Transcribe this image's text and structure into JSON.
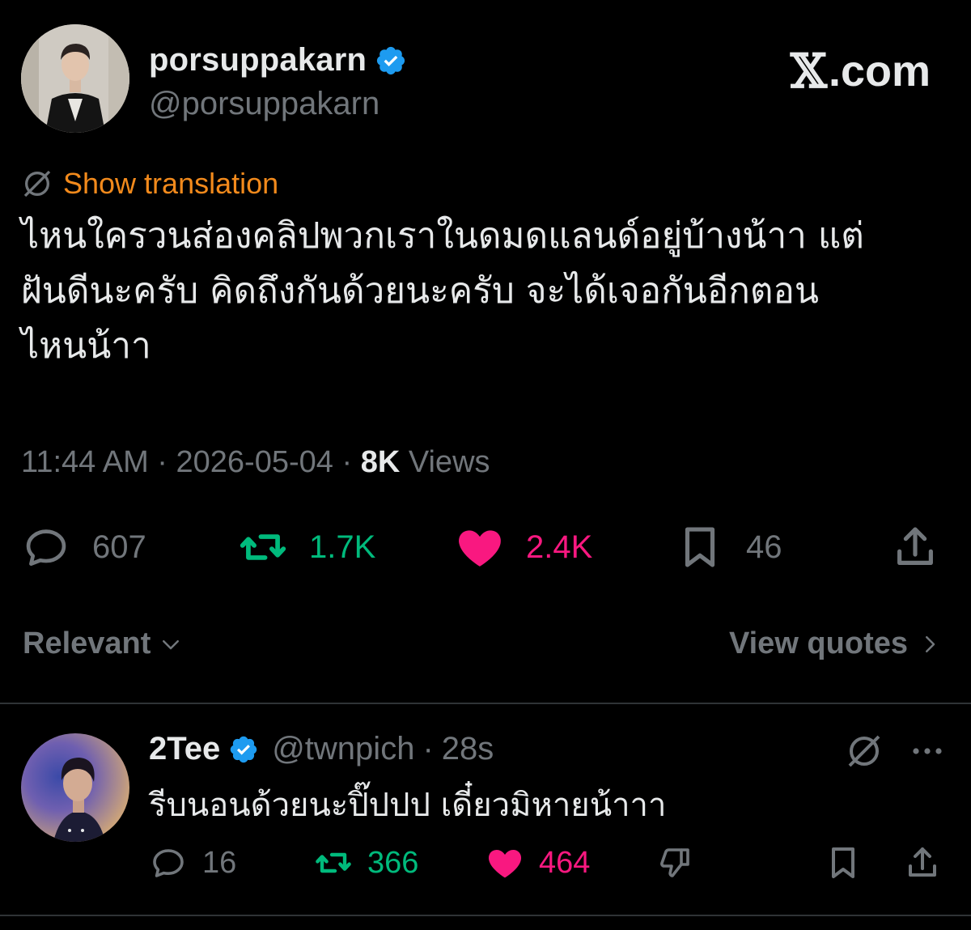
{
  "author": {
    "display_name": "porsuppakarn",
    "handle": "@porsuppakarn",
    "verified_color": "#1d9bf0"
  },
  "brand": {
    "logo_text": "com",
    "logo_prefix": "X."
  },
  "translation": {
    "label": "Show translation",
    "color": "#f28a1c"
  },
  "tweet": {
    "text_line1": "ไหนใครวนส่องคลิปพวกเราในดมดแลนด์อยู่บ้างน้าา แต่",
    "text_line2": "ฝันดีนะครับ คิดถึงกันด้วยนะครับ จะได้เจอกันอีกตอน",
    "text_line3": "ไหนน้าา",
    "time": "11:44 AM",
    "date": "2026-05-04",
    "views_count": "8K",
    "views_label": "Views"
  },
  "stats": {
    "replies": "607",
    "reposts": "1.7K",
    "likes": "2.4K",
    "bookmarks": "46"
  },
  "colors": {
    "repost": "#00ba7c",
    "like": "#f91880",
    "muted": "#71767b",
    "text": "#e7e9ea"
  },
  "sort": {
    "label": "Relevant",
    "view_quotes": "View quotes"
  },
  "reply": {
    "display_name": "2Tee",
    "handle": "@twnpich",
    "time": "28s",
    "text": "รีบนอนด้วยนะปิ๊ปปป เดี๋ยวมิหายน้าาา",
    "replies": "16",
    "reposts": "366",
    "likes": "464"
  },
  "icons": {
    "reply": "speech-bubble-icon",
    "repost": "repost-arrows-icon",
    "like": "heart-filled-icon",
    "bookmark": "bookmark-icon",
    "share": "share-upload-icon",
    "translate": "globe-slash-icon",
    "more": "more-dots-icon",
    "dislike": "thumbs-down-icon",
    "chevron_down": "chevron-down-icon",
    "chevron_right": "chevron-right-icon"
  }
}
